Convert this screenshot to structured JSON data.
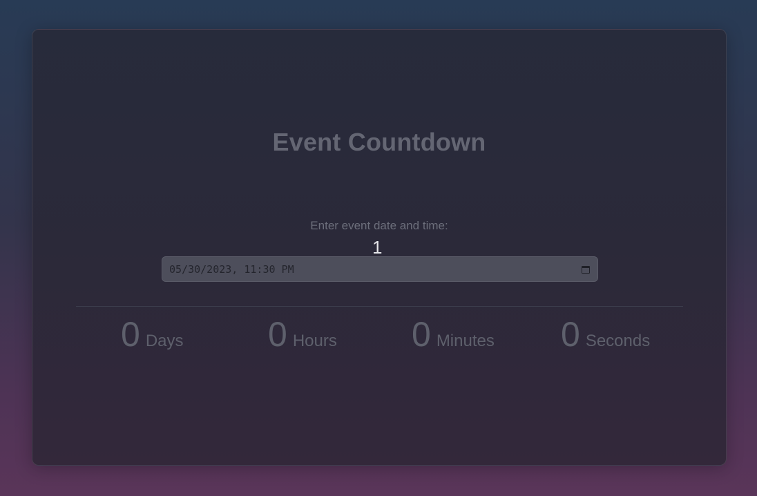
{
  "app": {
    "title": "Event Countdown"
  },
  "form": {
    "label": "Enter event date and time:",
    "typed_char": "1",
    "datetime_value": "05/30/2023, 11:30 PM",
    "calendar_icon": "calendar-icon"
  },
  "countdown": {
    "days": {
      "value": "0",
      "unit": "Days"
    },
    "hours": {
      "value": "0",
      "unit": "Hours"
    },
    "minutes": {
      "value": "0",
      "unit": "Minutes"
    },
    "seconds": {
      "value": "0",
      "unit": "Seconds"
    }
  },
  "colors": {
    "background_top": "#283b55",
    "background_bottom": "#5a3559",
    "card": "#2b2939",
    "muted_text": "#646673",
    "input_bg": "#4d4e5b"
  }
}
